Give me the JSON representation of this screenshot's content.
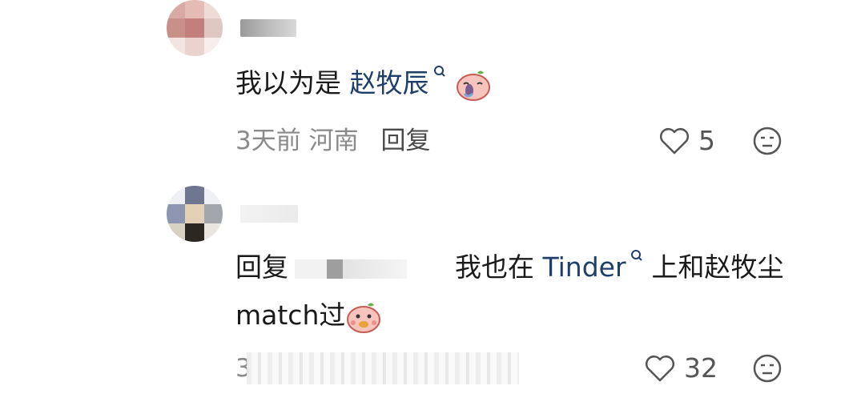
{
  "comments": [
    {
      "text_before": "我以为是 ",
      "link_text": "赵牧辰",
      "time": "3天前",
      "location": "河南",
      "reply_label": "回复",
      "likes": "5"
    },
    {
      "reply_prefix": "回复",
      "text_mid": "我也在 ",
      "link_text": "Tinder",
      "text_after": "上和赵牧尘",
      "line2": "match过",
      "time_partial": "3",
      "likes": "32"
    }
  ],
  "icons": [
    "search-icon",
    "sticker-emoji",
    "heart-icon",
    "dislike-icon"
  ],
  "colors": {
    "link": "#1f3f6b",
    "meta": "#8a8a8a",
    "text": "#1a1a1a"
  }
}
